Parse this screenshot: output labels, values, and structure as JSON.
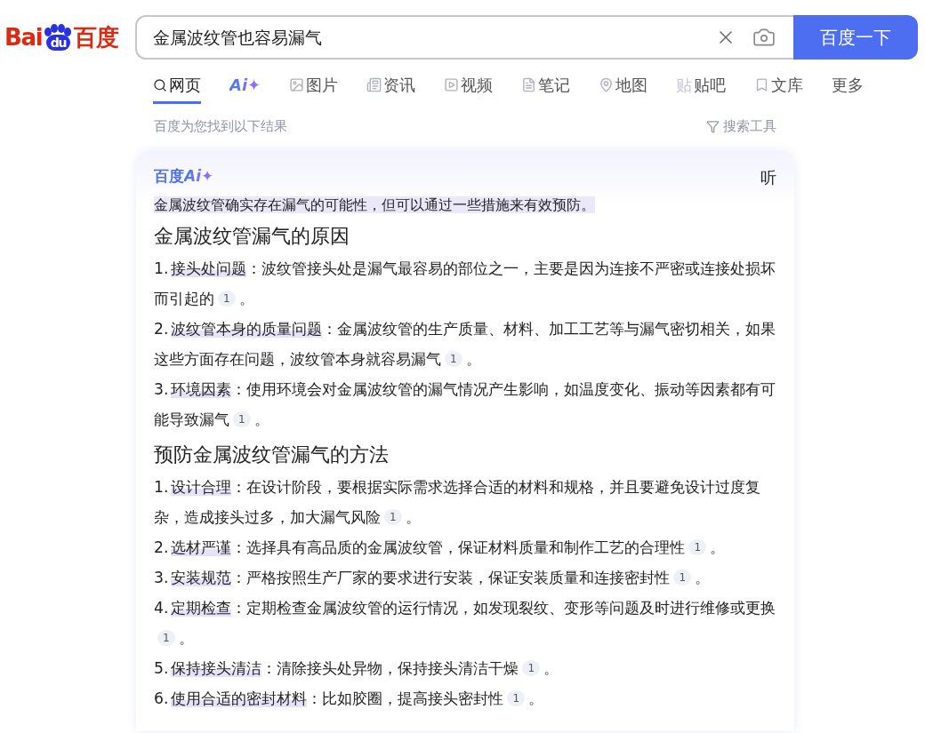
{
  "logo": {
    "part_1": "Bai",
    "part_2": "du",
    "part_3": "百度"
  },
  "search": {
    "value": "金属波纹管也容易漏气",
    "button": "百度一下"
  },
  "tabs": [
    {
      "label": "网页",
      "kind": "search",
      "selected": true
    },
    {
      "label": "Ai✦",
      "kind": "ai",
      "selected": false
    },
    {
      "label": "图片",
      "kind": "image",
      "selected": false
    },
    {
      "label": "资讯",
      "kind": "news",
      "selected": false
    },
    {
      "label": "视频",
      "kind": "video",
      "selected": false
    },
    {
      "label": "笔记",
      "kind": "note",
      "selected": false
    },
    {
      "label": "地图",
      "kind": "map",
      "selected": false
    },
    {
      "label": "贴吧",
      "kind": "tieba",
      "icon_text": "贴",
      "selected": false
    },
    {
      "label": "文库",
      "kind": "doc",
      "selected": false
    },
    {
      "label": "更多",
      "kind": "plain",
      "selected": false
    }
  ],
  "result_info": "百度为您找到以下结果",
  "search_tools": "搜索工具",
  "ai_card": {
    "brand": "百度",
    "brand_ai": "Ai✦",
    "listen": "听",
    "summary": "金属波纹管确实存在漏气的可能性，但可以通过一些措施来有效预防。",
    "sections": [
      {
        "heading": "金属波纹管漏气的原因",
        "items": [
          {
            "number": "1.",
            "term": "接头处问题",
            "text": "：波纹管接头处是漏气最容易的部位之一，主要是因为连接不严密或连接处损坏而引起的",
            "citation": "1",
            "end": "。"
          },
          {
            "number": "2.",
            "term": "波纹管本身的质量问题",
            "text": "：金属波纹管的生产质量、材料、加工工艺等与漏气密切相关，如果这些方面存在问题，波纹管本身就容易漏气",
            "citation": "1",
            "end": "。"
          },
          {
            "number": "3.",
            "term": "环境因素",
            "text": "：使用环境会对金属波纹管的漏气情况产生影响，如温度变化、振动等因素都有可能导致漏气",
            "citation": "1",
            "end": "。"
          }
        ]
      },
      {
        "heading": "预防金属波纹管漏气的方法",
        "items": [
          {
            "number": "1.",
            "term": "设计合理",
            "text": "：在设计阶段，要根据实际需求选择合适的材料和规格，并且要避免设计过度复杂，造成接头过多，加大漏气风险",
            "citation": "1",
            "end": "。"
          },
          {
            "number": "2.",
            "term": "选材严谨",
            "text": "：选择具有高品质的金属波纹管，保证材料质量和制作工艺的合理性",
            "citation": "1",
            "end": "。"
          },
          {
            "number": "3.",
            "term": "安装规范",
            "text": "：严格按照生产厂家的要求进行安装，保证安装质量和连接密封性",
            "citation": "1",
            "end": "。"
          },
          {
            "number": "4.",
            "term": "定期检查",
            "text": "：定期检查金属波纹管的运行情况，如发现裂纹、变形等问题及时进行维修或更换",
            "citation": "1",
            "end": "。"
          },
          {
            "number": "5.",
            "term": "保持接头清洁",
            "text": "：清除接头处异物，保持接头清洁干燥",
            "citation": "1",
            "end": "。"
          },
          {
            "number": "6.",
            "term": "使用合适的密封材料",
            "text": "：比如胶圈，提高接头密封性",
            "citation": "1",
            "end": "。"
          }
        ]
      }
    ]
  }
}
